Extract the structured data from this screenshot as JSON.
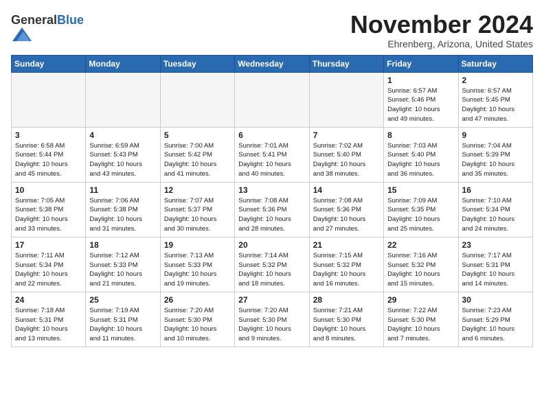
{
  "header": {
    "logo_general": "General",
    "logo_blue": "Blue",
    "month": "November 2024",
    "location": "Ehrenberg, Arizona, United States"
  },
  "days_of_week": [
    "Sunday",
    "Monday",
    "Tuesday",
    "Wednesday",
    "Thursday",
    "Friday",
    "Saturday"
  ],
  "weeks": [
    [
      {
        "day": "",
        "info": ""
      },
      {
        "day": "",
        "info": ""
      },
      {
        "day": "",
        "info": ""
      },
      {
        "day": "",
        "info": ""
      },
      {
        "day": "",
        "info": ""
      },
      {
        "day": "1",
        "info": "Sunrise: 6:57 AM\nSunset: 5:46 PM\nDaylight: 10 hours\nand 49 minutes."
      },
      {
        "day": "2",
        "info": "Sunrise: 6:57 AM\nSunset: 5:45 PM\nDaylight: 10 hours\nand 47 minutes."
      }
    ],
    [
      {
        "day": "3",
        "info": "Sunrise: 6:58 AM\nSunset: 5:44 PM\nDaylight: 10 hours\nand 45 minutes."
      },
      {
        "day": "4",
        "info": "Sunrise: 6:59 AM\nSunset: 5:43 PM\nDaylight: 10 hours\nand 43 minutes."
      },
      {
        "day": "5",
        "info": "Sunrise: 7:00 AM\nSunset: 5:42 PM\nDaylight: 10 hours\nand 41 minutes."
      },
      {
        "day": "6",
        "info": "Sunrise: 7:01 AM\nSunset: 5:41 PM\nDaylight: 10 hours\nand 40 minutes."
      },
      {
        "day": "7",
        "info": "Sunrise: 7:02 AM\nSunset: 5:40 PM\nDaylight: 10 hours\nand 38 minutes."
      },
      {
        "day": "8",
        "info": "Sunrise: 7:03 AM\nSunset: 5:40 PM\nDaylight: 10 hours\nand 36 minutes."
      },
      {
        "day": "9",
        "info": "Sunrise: 7:04 AM\nSunset: 5:39 PM\nDaylight: 10 hours\nand 35 minutes."
      }
    ],
    [
      {
        "day": "10",
        "info": "Sunrise: 7:05 AM\nSunset: 5:38 PM\nDaylight: 10 hours\nand 33 minutes."
      },
      {
        "day": "11",
        "info": "Sunrise: 7:06 AM\nSunset: 5:38 PM\nDaylight: 10 hours\nand 31 minutes."
      },
      {
        "day": "12",
        "info": "Sunrise: 7:07 AM\nSunset: 5:37 PM\nDaylight: 10 hours\nand 30 minutes."
      },
      {
        "day": "13",
        "info": "Sunrise: 7:08 AM\nSunset: 5:36 PM\nDaylight: 10 hours\nand 28 minutes."
      },
      {
        "day": "14",
        "info": "Sunrise: 7:08 AM\nSunset: 5:36 PM\nDaylight: 10 hours\nand 27 minutes."
      },
      {
        "day": "15",
        "info": "Sunrise: 7:09 AM\nSunset: 5:35 PM\nDaylight: 10 hours\nand 25 minutes."
      },
      {
        "day": "16",
        "info": "Sunrise: 7:10 AM\nSunset: 5:34 PM\nDaylight: 10 hours\nand 24 minutes."
      }
    ],
    [
      {
        "day": "17",
        "info": "Sunrise: 7:11 AM\nSunset: 5:34 PM\nDaylight: 10 hours\nand 22 minutes."
      },
      {
        "day": "18",
        "info": "Sunrise: 7:12 AM\nSunset: 5:33 PM\nDaylight: 10 hours\nand 21 minutes."
      },
      {
        "day": "19",
        "info": "Sunrise: 7:13 AM\nSunset: 5:33 PM\nDaylight: 10 hours\nand 19 minutes."
      },
      {
        "day": "20",
        "info": "Sunrise: 7:14 AM\nSunset: 5:32 PM\nDaylight: 10 hours\nand 18 minutes."
      },
      {
        "day": "21",
        "info": "Sunrise: 7:15 AM\nSunset: 5:32 PM\nDaylight: 10 hours\nand 16 minutes."
      },
      {
        "day": "22",
        "info": "Sunrise: 7:16 AM\nSunset: 5:32 PM\nDaylight: 10 hours\nand 15 minutes."
      },
      {
        "day": "23",
        "info": "Sunrise: 7:17 AM\nSunset: 5:31 PM\nDaylight: 10 hours\nand 14 minutes."
      }
    ],
    [
      {
        "day": "24",
        "info": "Sunrise: 7:18 AM\nSunset: 5:31 PM\nDaylight: 10 hours\nand 13 minutes."
      },
      {
        "day": "25",
        "info": "Sunrise: 7:19 AM\nSunset: 5:31 PM\nDaylight: 10 hours\nand 11 minutes."
      },
      {
        "day": "26",
        "info": "Sunrise: 7:20 AM\nSunset: 5:30 PM\nDaylight: 10 hours\nand 10 minutes."
      },
      {
        "day": "27",
        "info": "Sunrise: 7:20 AM\nSunset: 5:30 PM\nDaylight: 10 hours\nand 9 minutes."
      },
      {
        "day": "28",
        "info": "Sunrise: 7:21 AM\nSunset: 5:30 PM\nDaylight: 10 hours\nand 8 minutes."
      },
      {
        "day": "29",
        "info": "Sunrise: 7:22 AM\nSunset: 5:30 PM\nDaylight: 10 hours\nand 7 minutes."
      },
      {
        "day": "30",
        "info": "Sunrise: 7:23 AM\nSunset: 5:29 PM\nDaylight: 10 hours\nand 6 minutes."
      }
    ]
  ]
}
